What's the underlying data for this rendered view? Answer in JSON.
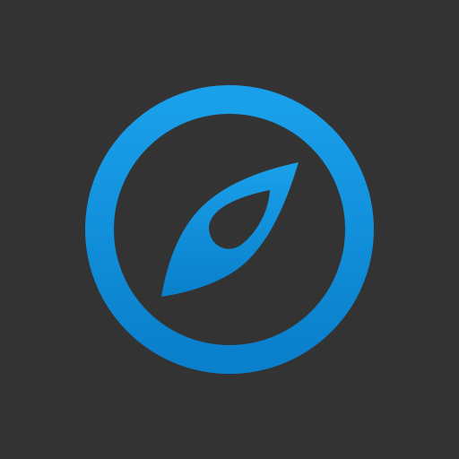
{
  "icon": {
    "name": "compass-icon",
    "colors": {
      "background": "#333333",
      "accent_top": "#1aa0ea",
      "accent_bottom": "#0a7fcb"
    }
  }
}
